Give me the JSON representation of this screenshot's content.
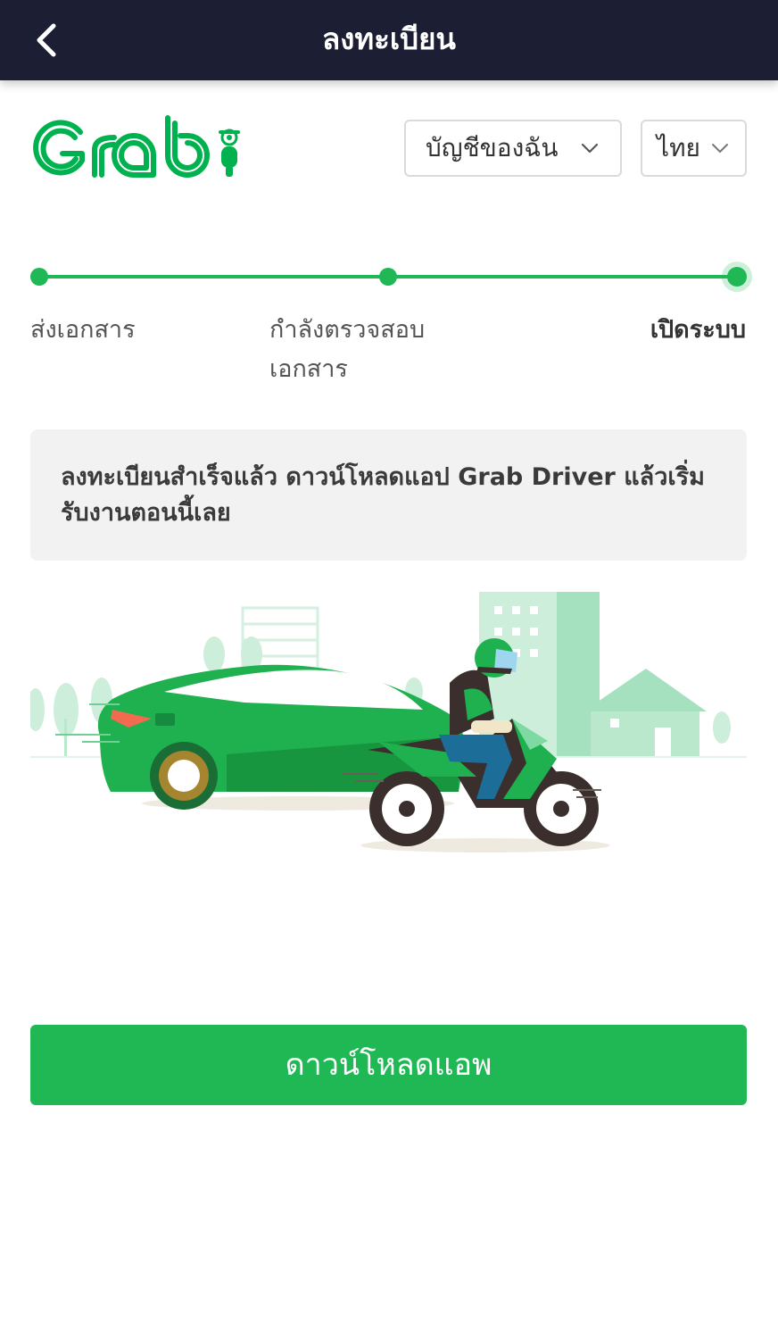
{
  "appbar": {
    "title": "ลงทะเบียน",
    "back_icon": "chevron-left-icon"
  },
  "brand": {
    "name": "Grab",
    "color": "#00b14f",
    "mascot_icon": "scooter-icon"
  },
  "account_select": {
    "value": "บัญชีของฉัน",
    "icon": "chevron-down-icon"
  },
  "language_select": {
    "value": "ไทย",
    "icon": "chevron-down-icon"
  },
  "stepper": {
    "steps": [
      {
        "label": "ส่งเอกสาร",
        "state": "done"
      },
      {
        "label": "กำลังตรวจสอบ เอกสาร",
        "state": "done"
      },
      {
        "label": "เปิดระบบ",
        "state": "current"
      }
    ],
    "active_color": "#1fb855"
  },
  "notice": {
    "text": "ลงทะเบียนสำเร็จแล้ว ดาวน์โหลดแอป Grab Driver แล้วเริ่มรับงานตอนนี้เลย"
  },
  "illustration": {
    "description_icon": "car-and-motorbike-illustration"
  },
  "actions": {
    "download_label": "ดาวน์โหลดแอพ",
    "button_color": "#1fb855"
  },
  "colors": {
    "header_bg": "#1c1f33",
    "notice_bg": "#f2f2f3"
  }
}
